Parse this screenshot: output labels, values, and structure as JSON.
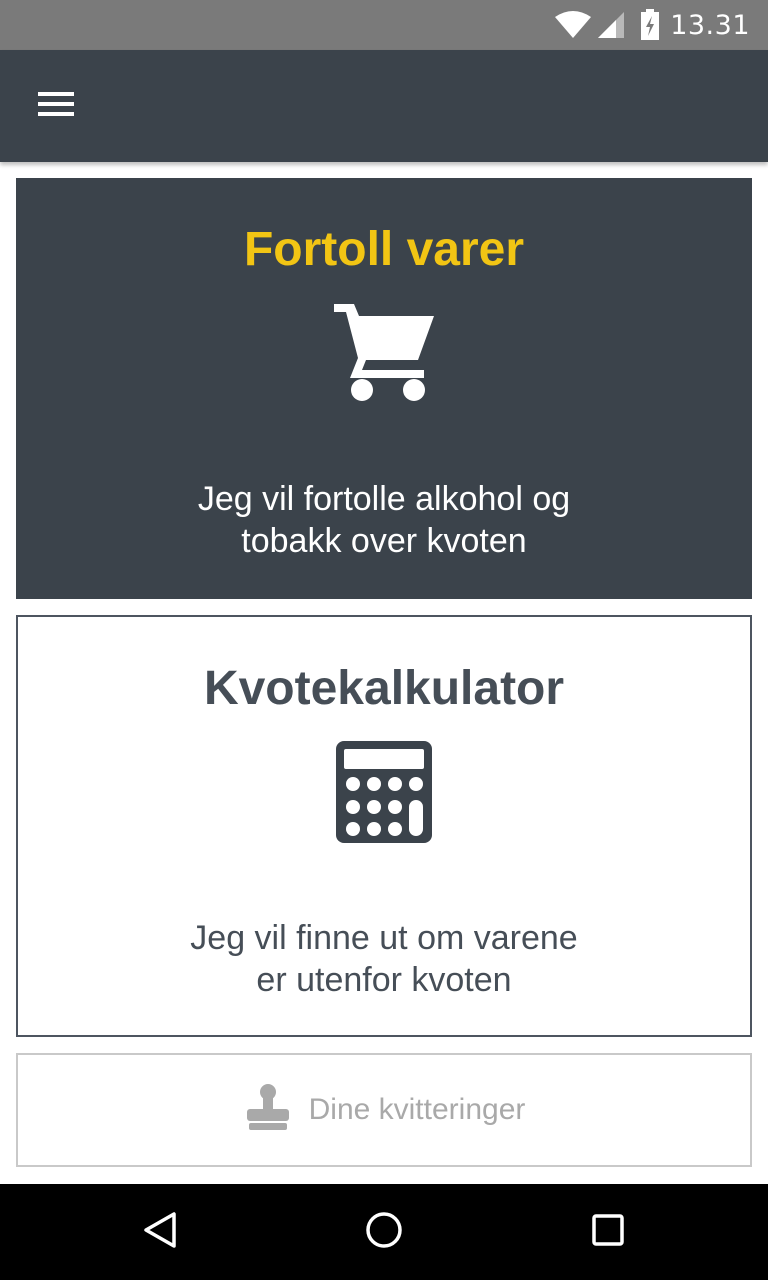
{
  "status_bar": {
    "time": "13.31",
    "icons": [
      "wifi-icon",
      "signal-icon",
      "battery-charging-icon"
    ]
  },
  "app_bar": {
    "menu_icon": "hamburger-menu-icon"
  },
  "cards": {
    "declare": {
      "title": "Fortoll varer",
      "icon": "shopping-cart-icon",
      "description_line1": "Jeg vil fortolle alkohol og",
      "description_line2": "tobakk over kvoten"
    },
    "calculator": {
      "title": "Kvotekalkulator",
      "icon": "calculator-icon",
      "description_line1": "Jeg vil finne ut om varene",
      "description_line2": "er utenfor kvoten"
    }
  },
  "receipts": {
    "label": "Dine kvitteringer",
    "icon": "stamp-icon"
  },
  "colors": {
    "dark": "#3b434b",
    "accent_yellow": "#f2c514",
    "text_dark": "#464e57",
    "disabled_gray": "#a9a9a9"
  },
  "nav_bar": {
    "icons": [
      "back-icon",
      "home-icon",
      "recents-icon"
    ]
  }
}
